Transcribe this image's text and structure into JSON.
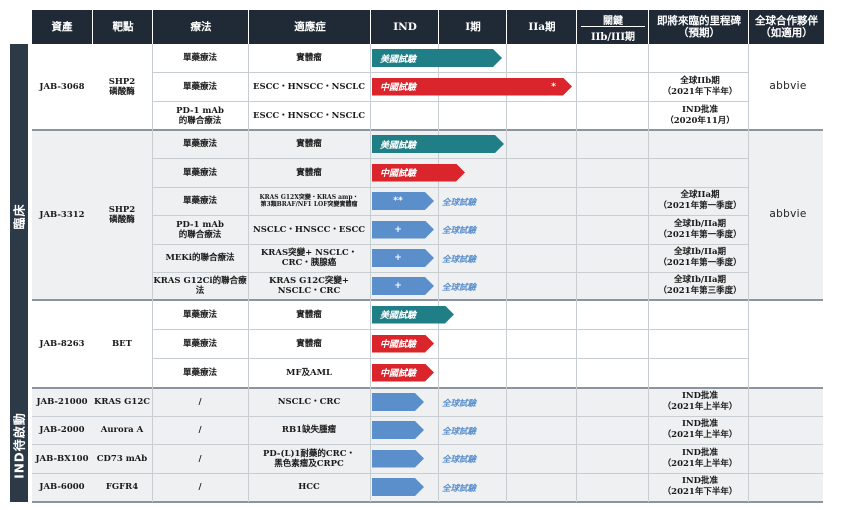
{
  "header": {
    "asset": "資產",
    "target": "靶點",
    "therapy": "療法",
    "indication": "適應症",
    "ind": "IND",
    "phase1": "I期",
    "phase2a": "IIa期",
    "pivotal": "關鍵",
    "pivotal_sub": "IIb/III期",
    "milestone": "即將來臨的里程碑\n（預期）",
    "partner": "全球合作夥伴\n（如適用）"
  },
  "sections": {
    "clinical": "臨床",
    "ind_enabling": "IND待啟動"
  },
  "rows": [
    {
      "therapy": "單藥療法",
      "indication": "實體瘤",
      "bar": "美國試驗",
      "milestone": ""
    },
    {
      "therapy": "單藥療法",
      "indication": "ESCC・HNSCC・NSCLC",
      "bar": "中國試驗",
      "mark": "*",
      "milestone": "全球IIb期\n（2021年下半年）"
    },
    {
      "therapy": "PD-1 mAb\n的聯合療法",
      "indication": "ESCC・HNSCC・NSCLC",
      "milestone": "IND批准\n（2020年11月）"
    },
    {
      "therapy": "單藥療法",
      "indication": "實體瘤",
      "bar": "美國試驗",
      "milestone": ""
    },
    {
      "therapy": "單藥療法",
      "indication": "實體瘤",
      "bar": "中國試驗",
      "milestone": ""
    },
    {
      "therapy": "單藥療法",
      "indication": "KRAS G12X突變・KRAS amp・\n第3類BRAF/NF1 LOF突變實體瘤",
      "mark": "**",
      "global": "全球試驗",
      "milestone": "全球IIa期\n（2021年第一季度）"
    },
    {
      "therapy": "PD-1 mAb\n的聯合療法",
      "indication": "NSCLC・HNSCC・ESCC",
      "mark": "+",
      "global": "全球試驗",
      "milestone": "全球Ib/IIa期\n（2021年第一季度）"
    },
    {
      "therapy": "MEKi的聯合療法",
      "indication": "KRAS突變+ NSCLC・\nCRC・胰腺癌",
      "mark": "+",
      "global": "全球試驗",
      "milestone": "全球Ib/IIa期\n（2021年第一季度）"
    },
    {
      "therapy": "KRAS G12Ci的聯合療法",
      "indication": "KRAS G12C突變+\nNSCLC・CRC",
      "mark": "+",
      "global": "全球試驗",
      "milestone": "全球Ib/IIa期\n（2021年第三季度）"
    },
    {
      "therapy": "單藥療法",
      "indication": "實體瘤",
      "bar": "美國試驗",
      "milestone": ""
    },
    {
      "therapy": "單藥療法",
      "indication": "實體瘤",
      "bar": "中國試驗",
      "milestone": ""
    },
    {
      "therapy": "單藥療法",
      "indication": "MF及AML",
      "bar": "中國試驗",
      "milestone": ""
    },
    {
      "asset": "JAB-21000",
      "target": "KRAS G12C",
      "therapy": "/",
      "indication": "NSCLC・CRC",
      "global": "全球試驗",
      "milestone": "IND批准\n（2021年上半年）"
    },
    {
      "asset": "JAB-2000",
      "target": "Aurora A",
      "therapy": "/",
      "indication": "RB1缺失腫瘤",
      "global": "全球試驗",
      "milestone": "IND批准\n（2021年上半年）"
    },
    {
      "asset": "JAB-BX100",
      "target": "CD73 mAb",
      "therapy": "/",
      "indication": "PD-(L)1耐藥的CRC・\n黑色素瘤及CRPC",
      "global": "全球試驗",
      "milestone": "IND批准\n（2021年上半年）"
    },
    {
      "asset": "JAB-6000",
      "target": "FGFR4",
      "therapy": "/",
      "indication": "HCC",
      "global": "全球試驗",
      "milestone": "IND批准\n（2021年下半年）"
    }
  ],
  "assets": {
    "a1": {
      "name": "JAB-3068",
      "target": "SHP2\n磷酸酶"
    },
    "a2": {
      "name": "JAB-3312",
      "target": "SHP2\n磷酸酶"
    },
    "a3": {
      "name": "JAB-8263",
      "target": "BET"
    }
  },
  "partners": {
    "p1": "abbvie",
    "p2": "abbvie"
  },
  "colors": {
    "header": "#1f2a36",
    "teal": "#1f7e86",
    "red": "#d9252b",
    "blue": "#5b8fcc",
    "shade": "#eef0f2"
  }
}
